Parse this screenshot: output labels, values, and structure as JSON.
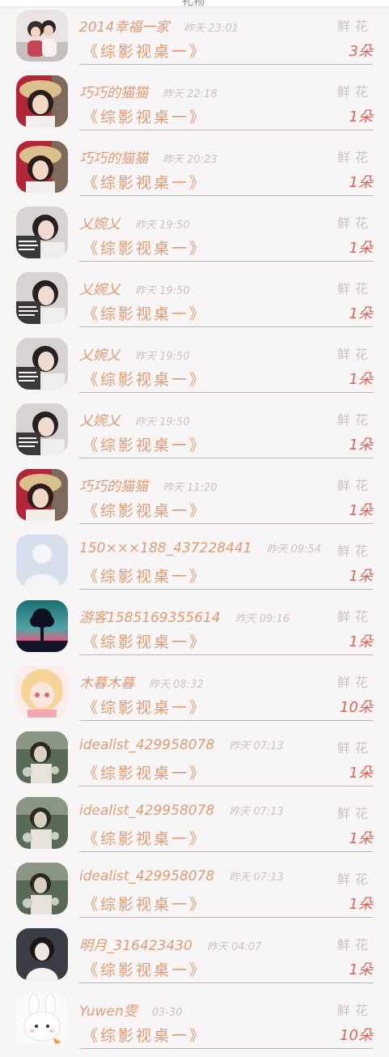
{
  "header": {
    "title": "礼物"
  },
  "rows": [
    {
      "name": "2014幸福一家",
      "time": "昨天 23:01",
      "gift": "《综影视桌一》",
      "type": "鲜花",
      "count": "3朵",
      "avatar": "couple-avatar"
    },
    {
      "name": "巧巧的猫猫",
      "time": "昨天 22:18",
      "gift": "《综影视桌一》",
      "type": "鲜花",
      "count": "1朵",
      "avatar": "girl-hat-avatar"
    },
    {
      "name": "巧巧的猫猫",
      "time": "昨天 20:23",
      "gift": "《综影视桌一》",
      "type": "鲜花",
      "count": "1朵",
      "avatar": "girl-hat-avatar"
    },
    {
      "name": "乂婉乂",
      "time": "昨天 19:50",
      "gift": "《综影视桌一》",
      "type": "鲜花",
      "count": "1朵",
      "avatar": "girl-text-avatar"
    },
    {
      "name": "乂婉乂",
      "time": "昨天 19:50",
      "gift": "《综影视桌一》",
      "type": "鲜花",
      "count": "1朵",
      "avatar": "girl-text-avatar"
    },
    {
      "name": "乂婉乂",
      "time": "昨天 19:50",
      "gift": "《综影视桌一》",
      "type": "鲜花",
      "count": "1朵",
      "avatar": "girl-text-avatar"
    },
    {
      "name": "乂婉乂",
      "time": "昨天 19:50",
      "gift": "《综影视桌一》",
      "type": "鲜花",
      "count": "1朵",
      "avatar": "girl-text-avatar"
    },
    {
      "name": "巧巧的猫猫",
      "time": "昨天 11:20",
      "gift": "《综影视桌一》",
      "type": "鲜花",
      "count": "1朵",
      "avatar": "girl-hat-avatar"
    },
    {
      "name": "150×××188_437228441",
      "time": "昨天 09:54",
      "gift": "《综影视桌一》",
      "type": "鲜花",
      "count": "1朵",
      "avatar": "default-user-avatar"
    },
    {
      "name": "游客1585169355614",
      "time": "昨天 09:16",
      "gift": "《综影视桌一》",
      "type": "鲜花",
      "count": "1朵",
      "avatar": "tree-sunset-avatar"
    },
    {
      "name": "木暮木暮",
      "time": "昨天 08:32",
      "gift": "《综影视桌一》",
      "type": "鲜花",
      "count": "10朵",
      "avatar": "anime-girl-avatar"
    },
    {
      "name": "idealist_429958078",
      "time": "昨天 07:13",
      "gift": "《综影视桌一》",
      "type": "鲜花",
      "count": "1朵",
      "avatar": "woman-flowers-avatar"
    },
    {
      "name": "idealist_429958078",
      "time": "昨天 07:13",
      "gift": "《综影视桌一》",
      "type": "鲜花",
      "count": "1朵",
      "avatar": "woman-flowers-avatar"
    },
    {
      "name": "idealist_429958078",
      "time": "昨天 07:13",
      "gift": "《综影视桌一》",
      "type": "鲜花",
      "count": "1朵",
      "avatar": "woman-flowers-avatar"
    },
    {
      "name": "明月_316423430",
      "time": "昨天 04:07",
      "gift": "《综影视桌一》",
      "type": "鲜花",
      "count": "1朵",
      "avatar": "woman-portrait-avatar"
    },
    {
      "name": "Yuwen雯",
      "time": "03-30",
      "gift": "《综影视桌一》",
      "type": "鲜花",
      "count": "10朵",
      "avatar": "bunny-avatar"
    }
  ],
  "colors": {
    "accent": "#dd9c76",
    "count": "#d9645a",
    "muted": "#c9c4c2",
    "background": "#f7f5f6"
  }
}
